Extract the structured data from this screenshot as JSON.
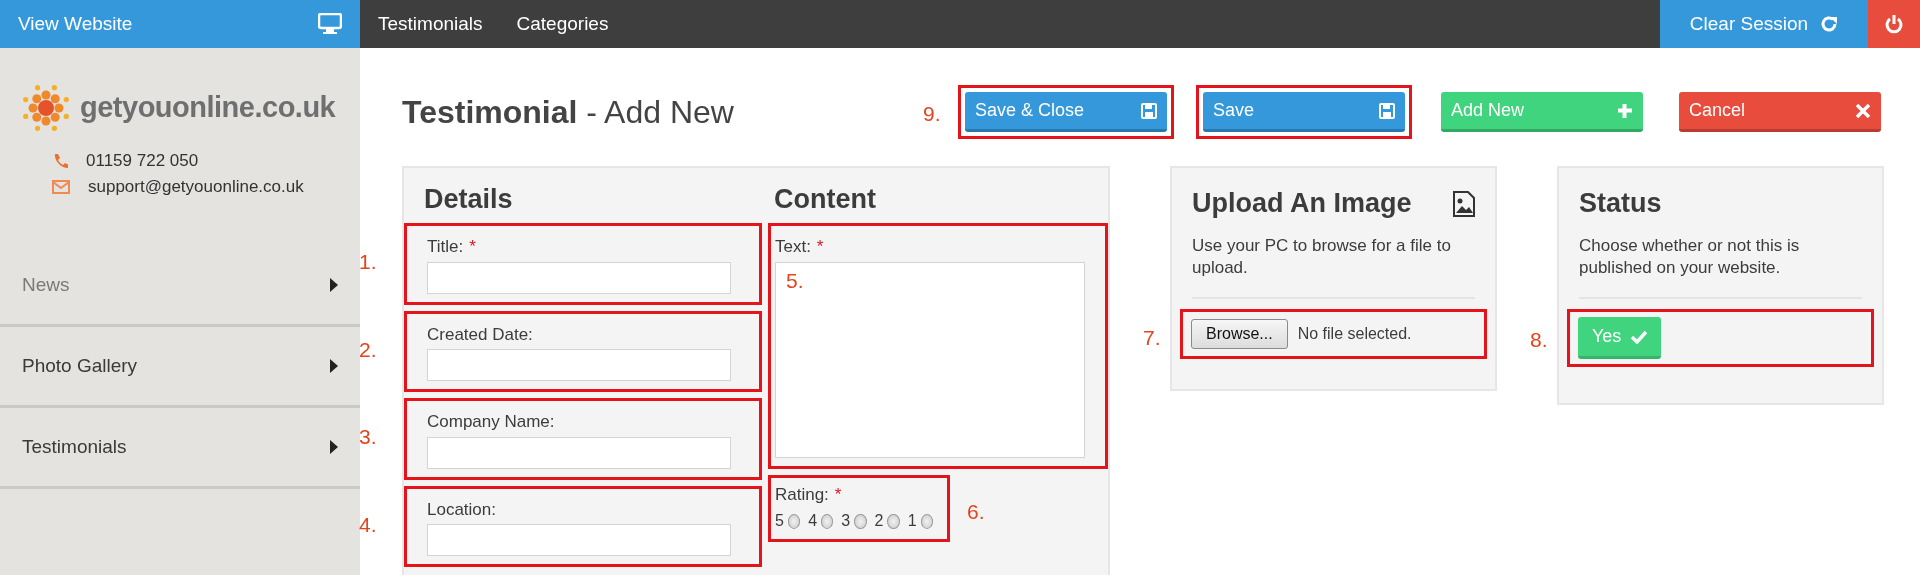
{
  "topbar": {
    "view_website": "View Website",
    "tabs": [
      {
        "label": "Testimonials"
      },
      {
        "label": "Categories"
      }
    ],
    "clear_session": "Clear Session"
  },
  "sidebar": {
    "logo_text": "getyouonline.co.uk",
    "phone": "01159 722 050",
    "email": "support@getyouonline.co.uk",
    "items": [
      {
        "label": "News",
        "muted": true
      },
      {
        "label": "Photo Gallery",
        "muted": false
      },
      {
        "label": "Testimonials",
        "muted": false
      }
    ]
  },
  "page": {
    "title": "Testimonial",
    "subtitle": "- Add New"
  },
  "actions": [
    {
      "label": "Save & Close",
      "kind": "save",
      "boxed": true,
      "annotation": "9."
    },
    {
      "label": "Save",
      "kind": "save",
      "boxed": true
    },
    {
      "label": "Add New",
      "kind": "add",
      "boxed": false
    },
    {
      "label": "Cancel",
      "kind": "cancel",
      "boxed": false
    }
  ],
  "details": {
    "heading": "Details",
    "fields": [
      {
        "label": "Title:",
        "required_mark": "*",
        "annotation": "1."
      },
      {
        "label": "Created Date:",
        "annotation": "2."
      },
      {
        "label": "Company Name:",
        "annotation": "3."
      },
      {
        "label": "Location:",
        "annotation": "4."
      }
    ]
  },
  "content": {
    "heading": "Content",
    "text": {
      "label": "Text:",
      "required_mark": "*",
      "annotation": "5."
    },
    "rating": {
      "label": "Rating:",
      "required_mark": "*",
      "annotation": "6.",
      "options": [
        {
          "label": "5",
          "selected": false
        },
        {
          "label": "4",
          "selected": false
        },
        {
          "label": "3",
          "selected": false
        },
        {
          "label": "2",
          "selected": false
        },
        {
          "label": "1",
          "selected": false
        }
      ]
    }
  },
  "upload": {
    "heading": "Upload An Image",
    "description": "Use your PC to browse for a file to upload.",
    "browse_button": "Browse...",
    "file_status": "No file selected.",
    "annotation": "7."
  },
  "status": {
    "heading": "Status",
    "description": "Choose whether or not this is published on your website.",
    "toggle": {
      "label": "Yes",
      "on": true
    },
    "annotation": "8."
  }
}
